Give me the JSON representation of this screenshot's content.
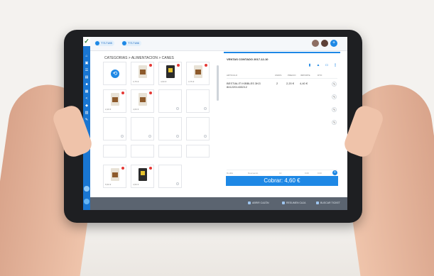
{
  "tickets": [
    {
      "label": "T717185"
    },
    {
      "label": "T717186"
    }
  ],
  "breadcrumb": "CATEGORIAS > ALIMENTACION > CANES",
  "grid": {
    "back_label": "⟲",
    "tiles": [
      {
        "price": "3,75 €",
        "type": "bag"
      },
      {
        "price": "4,50 €",
        "type": "dark"
      },
      {
        "price": "3,75 €",
        "type": "bag"
      },
      {
        "price": "2,20 €",
        "type": "bag"
      },
      {
        "price": "4,60 €",
        "type": "bag"
      },
      {
        "price": "5,50 €",
        "type": "bag"
      },
      {
        "price": "4,50 €",
        "type": "dark"
      }
    ]
  },
  "sale": {
    "title": "VENTAS CONTADO  2017-12-10",
    "columns": [
      "ARTICULO",
      "UNIDS",
      "PRECIO",
      "IMPORTE",
      "DTO"
    ],
    "line": {
      "name": "BESTIALITI KIBBLES 3KG",
      "code": "8412201433212",
      "units": "2",
      "price": "2,20 €",
      "amount": "4,40 €"
    },
    "footer": {
      "c1": "Rodillo",
      "c2": "Descuento",
      "c3": "13",
      "c4": "0,00",
      "c5": "0,00"
    },
    "pay_label": "Cobrar: 4,60 €"
  },
  "bottom": {
    "item1": "ABRIR CAJÓN",
    "item2": "RESUMEN CAJA",
    "item3": "BUSCAR TICKET"
  }
}
